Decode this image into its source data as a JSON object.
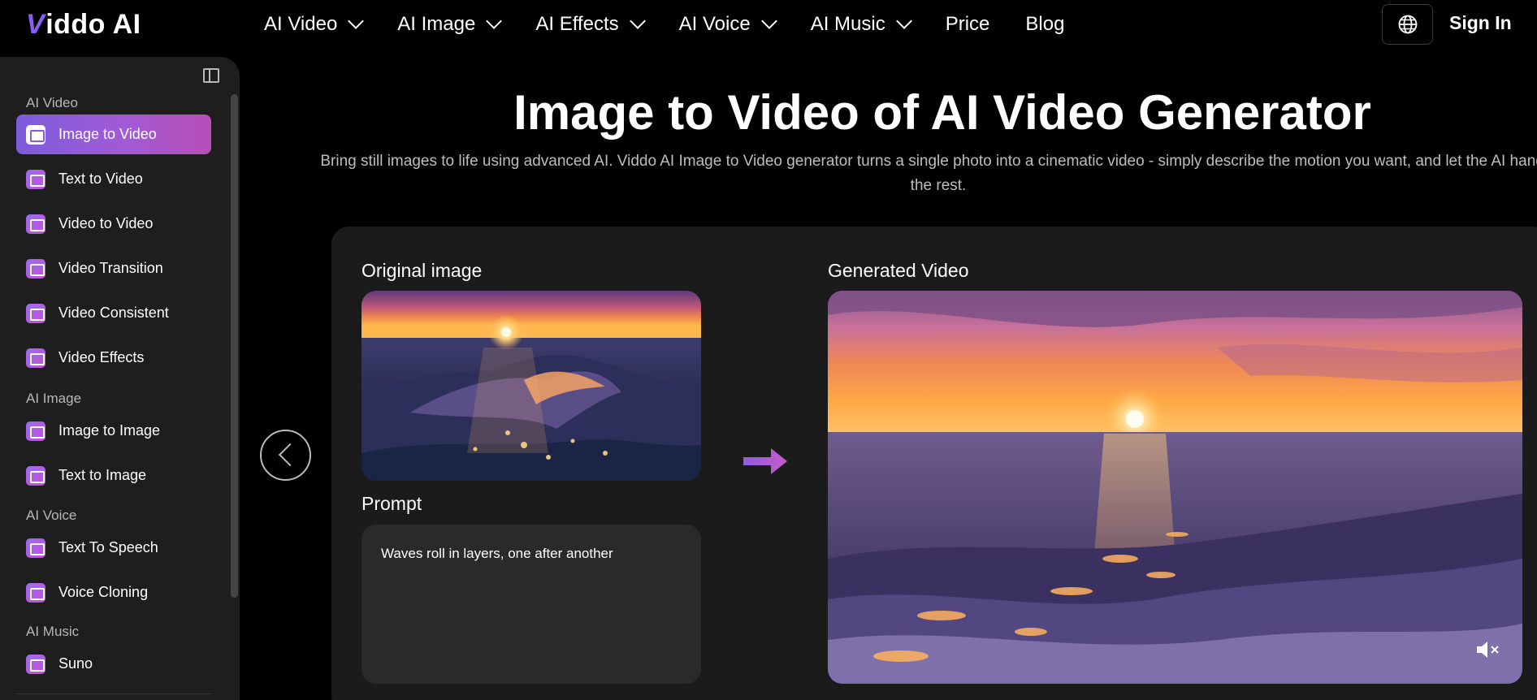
{
  "header": {
    "logo": "Viddo AI",
    "nav": [
      {
        "label": "AI Video",
        "has_dropdown": true
      },
      {
        "label": "AI Image",
        "has_dropdown": true
      },
      {
        "label": "AI Effects",
        "has_dropdown": true
      },
      {
        "label": "AI Voice",
        "has_dropdown": true
      },
      {
        "label": "AI Music",
        "has_dropdown": true
      },
      {
        "label": "Price",
        "has_dropdown": false
      },
      {
        "label": "Blog",
        "has_dropdown": false
      }
    ],
    "language_icon": "globe-icon",
    "sign_in": "Sign In"
  },
  "sidebar": {
    "collapse_icon": "sidebar-toggle-icon",
    "sections": [
      {
        "title": "AI Video",
        "items": [
          {
            "label": "Image to Video",
            "active": true
          },
          {
            "label": "Text to Video",
            "active": false
          },
          {
            "label": "Video to Video",
            "active": false
          },
          {
            "label": "Video Transition",
            "active": false
          },
          {
            "label": "Video Consistent",
            "active": false
          },
          {
            "label": "Video Effects",
            "active": false
          }
        ]
      },
      {
        "title": "AI Image",
        "items": [
          {
            "label": "Image to Image",
            "active": false
          },
          {
            "label": "Text to Image",
            "active": false
          }
        ]
      },
      {
        "title": "AI Voice",
        "items": [
          {
            "label": "Text To Speech",
            "active": false
          },
          {
            "label": "Voice Cloning",
            "active": false
          }
        ]
      },
      {
        "title": "AI Music",
        "items": [
          {
            "label": "Suno",
            "active": false
          }
        ]
      }
    ]
  },
  "hero": {
    "title": "Image to Video of AI Video Generator",
    "description": "Bring still images to life using advanced AI. Viddo AI Image to Video generator turns a single photo into a cinematic video - simply describe the motion you want, and let the AI handle the rest."
  },
  "demo": {
    "original_label": "Original image",
    "prompt_label": "Prompt",
    "prompt_text": "Waves roll in layers, one after another",
    "generated_label": "Generated Video",
    "colors": {
      "accent_start": "#7c5cdb",
      "accent_end": "#b64fb6",
      "card_bg": "#1b1b1b"
    }
  }
}
